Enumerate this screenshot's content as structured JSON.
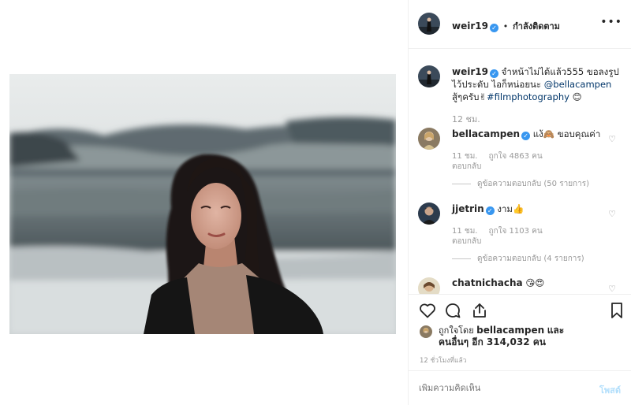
{
  "post": {
    "author": "weir19",
    "separator": "•",
    "follow_status": "กำลังติดตาม",
    "more_icon": "more-horizontal-icon",
    "caption_lines": [
      "จำหน้าไม่ได้แล้ว555 ขอลงรูป",
      "ไว้ประดับ ไอก็หน่อยนะ",
      "สู้ๆครับ"
    ],
    "caption_mention": "@bellacampen",
    "caption_emoji_1": "✌",
    "caption_hashtag": "#filmphotography",
    "caption_emoji_2": "😊",
    "caption_time": "12 ชม."
  },
  "comments": [
    {
      "username": "bellacampen",
      "text": "แง้🙈 ขอบคุณค่า",
      "time": "11 ชม.",
      "likes": "ถูกใจ 4863 คน",
      "reply": "ตอบกลับ",
      "view_replies": "ดูข้อความตอบกลับ (50 รายการ)"
    },
    {
      "username": "jjetrin",
      "text": "งาม👍",
      "time": "11 ชม.",
      "likes": "ถูกใจ 1103 คน",
      "reply": "ตอบกลับ",
      "view_replies": "ดูข้อความตอบกลับ (4 รายการ)"
    },
    {
      "username": "chatnichacha",
      "text": "😘😍"
    }
  ],
  "likes": {
    "prefix": "ถูกใจโดย",
    "user": "bellacampen",
    "and": "และ",
    "others": "คนอื่นๆ อีก 314,032 คน"
  },
  "post_time": "12 ชั่วโมงที่แล้ว",
  "add_comment": {
    "placeholder": "เพิ่มความคิดเห็น",
    "post_label": "โพสต์"
  },
  "icons": {
    "like": "heart-icon",
    "comment": "comment-icon",
    "share": "share-icon",
    "save": "bookmark-icon"
  },
  "colors": {
    "link": "#003569",
    "verified": "#3897f0",
    "muted": "#999999",
    "post_disabled": "#b2dffc"
  }
}
